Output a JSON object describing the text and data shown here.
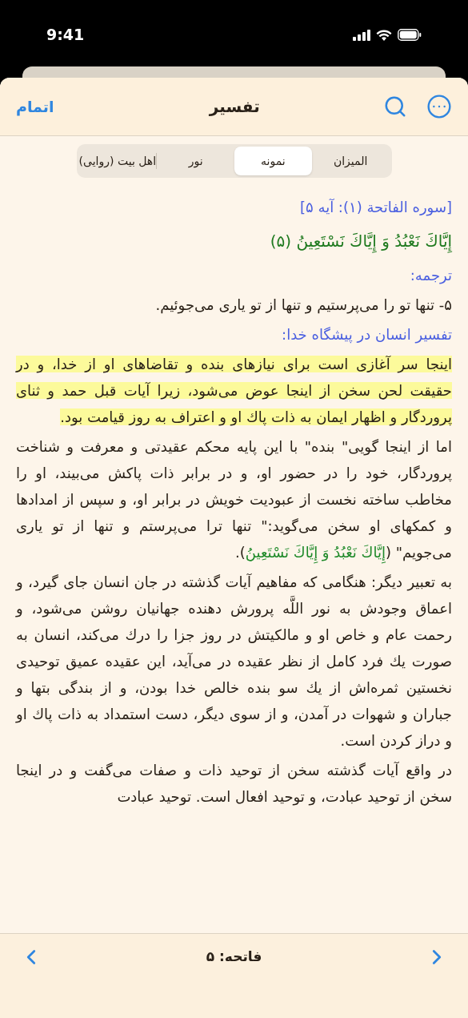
{
  "status_bar": {
    "time": "9:41"
  },
  "header": {
    "done": "اتمام",
    "title": "تفسیر"
  },
  "tabs": [
    {
      "label": "المیزان",
      "selected": false
    },
    {
      "label": "نمونه",
      "selected": true
    },
    {
      "label": "نور",
      "selected": false
    },
    {
      "label": "اهل بیت (روایی)",
      "selected": false
    }
  ],
  "content": [
    {
      "kind": "reference",
      "text": "[سوره الفاتحة (۱): آیه ۵]"
    },
    {
      "kind": "ayah",
      "text": "إِيَّاكَ نَعْبُدُ وَ إِيَّاكَ نَسْتَعِينُ (۵)"
    },
    {
      "kind": "label",
      "text": "ترجمه:"
    },
    {
      "kind": "text",
      "text": "۵- تنها تو را می‌پرستیم و تنها از تو یاری می‌جوئیم."
    },
    {
      "kind": "label",
      "text": "تفسیر انسان در پیشگاه خدا:"
    },
    {
      "kind": "paragraph",
      "highlighted": true,
      "segments": [
        {
          "text": "اینجا سر آغازی است برای نیازهای بنده و تقاضاهای او از خدا، و در حقیقت لحن سخن از اینجا عوض می‌شود، زیرا آیات قبل حمد و ثنای پروردگار و اظهار ایمان به ذات پاك او و اعتراف به روز قیامت بود.",
          "quran": false
        }
      ]
    },
    {
      "kind": "paragraph",
      "highlighted": false,
      "segments": [
        {
          "text": "اما از اینجا گویی\" بنده\" با این پایه محکم عقیدتی و معرفت و شناخت پروردگار، خود را در حضور او، و در برابر ذات پاکش می‌بیند، او را مخاطب ساخته نخست از عبودیت خویش در برابر او، و سپس از امدادها و کمکهای او سخن می‌گوید:\" تنها ترا می‌پرستم و تنها از تو یاری می‌جویم\" (",
          "quran": false
        },
        {
          "text": "إِيَّاكَ نَعْبُدُ وَ إِيَّاكَ نَسْتَعِينُ",
          "quran": true
        },
        {
          "text": ").",
          "quran": false
        }
      ]
    },
    {
      "kind": "paragraph",
      "highlighted": false,
      "segments": [
        {
          "text": "به تعبیر دیگر: هنگامی که مفاهیم آیات گذشته در جان انسان جای گیرد، و اعماق وجودش به نور اللَّه پرورش دهنده جهانیان روشن می‌شود، و رحمت عام و خاص او و مالکیتش در روز جزا را درك می‌کند، انسان به صورت یك فرد کامل از نظر عقیده در می‌آید، این عقیده عمیق توحیدی نخستین ثمره‌اش از یك سو بنده خالص خدا بودن، و از بندگی بتها و جباران و شهوات در آمدن، و از سوی دیگر، دست استمداد به ذات پاك او و دراز کردن است.",
          "quran": false
        }
      ]
    },
    {
      "kind": "paragraph",
      "highlighted": false,
      "segments": [
        {
          "text": "در واقع آیات گذشته سخن از توحید ذات و صفات می‌گفت و در اینجا سخن از توحید عبادت، و توحید افعال است. توحید عبادت",
          "quran": false
        }
      ]
    }
  ],
  "footer": {
    "title": "فاتحه: ۵"
  }
}
